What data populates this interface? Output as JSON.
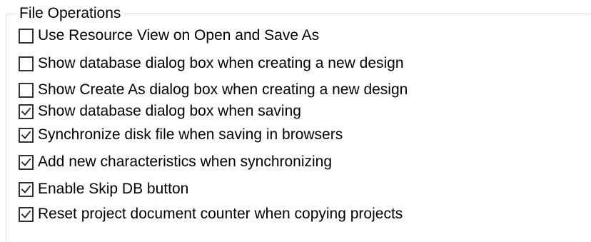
{
  "group": {
    "title": "File Operations",
    "options": [
      {
        "label": "Use Resource View on Open and Save As",
        "checked": false
      },
      {
        "label": "Show database dialog box when creating a new design",
        "checked": false
      },
      {
        "label": "Show Create As dialog box when creating a new design",
        "checked": false
      },
      {
        "label": "Show database dialog box when saving",
        "checked": true
      },
      {
        "label": "Synchronize disk file when saving in browsers",
        "checked": true
      },
      {
        "label": "Add new characteristics when synchronizing",
        "checked": true
      },
      {
        "label": "Enable Skip DB button",
        "checked": true
      },
      {
        "label": "Reset project document counter when copying projects",
        "checked": true
      }
    ]
  }
}
